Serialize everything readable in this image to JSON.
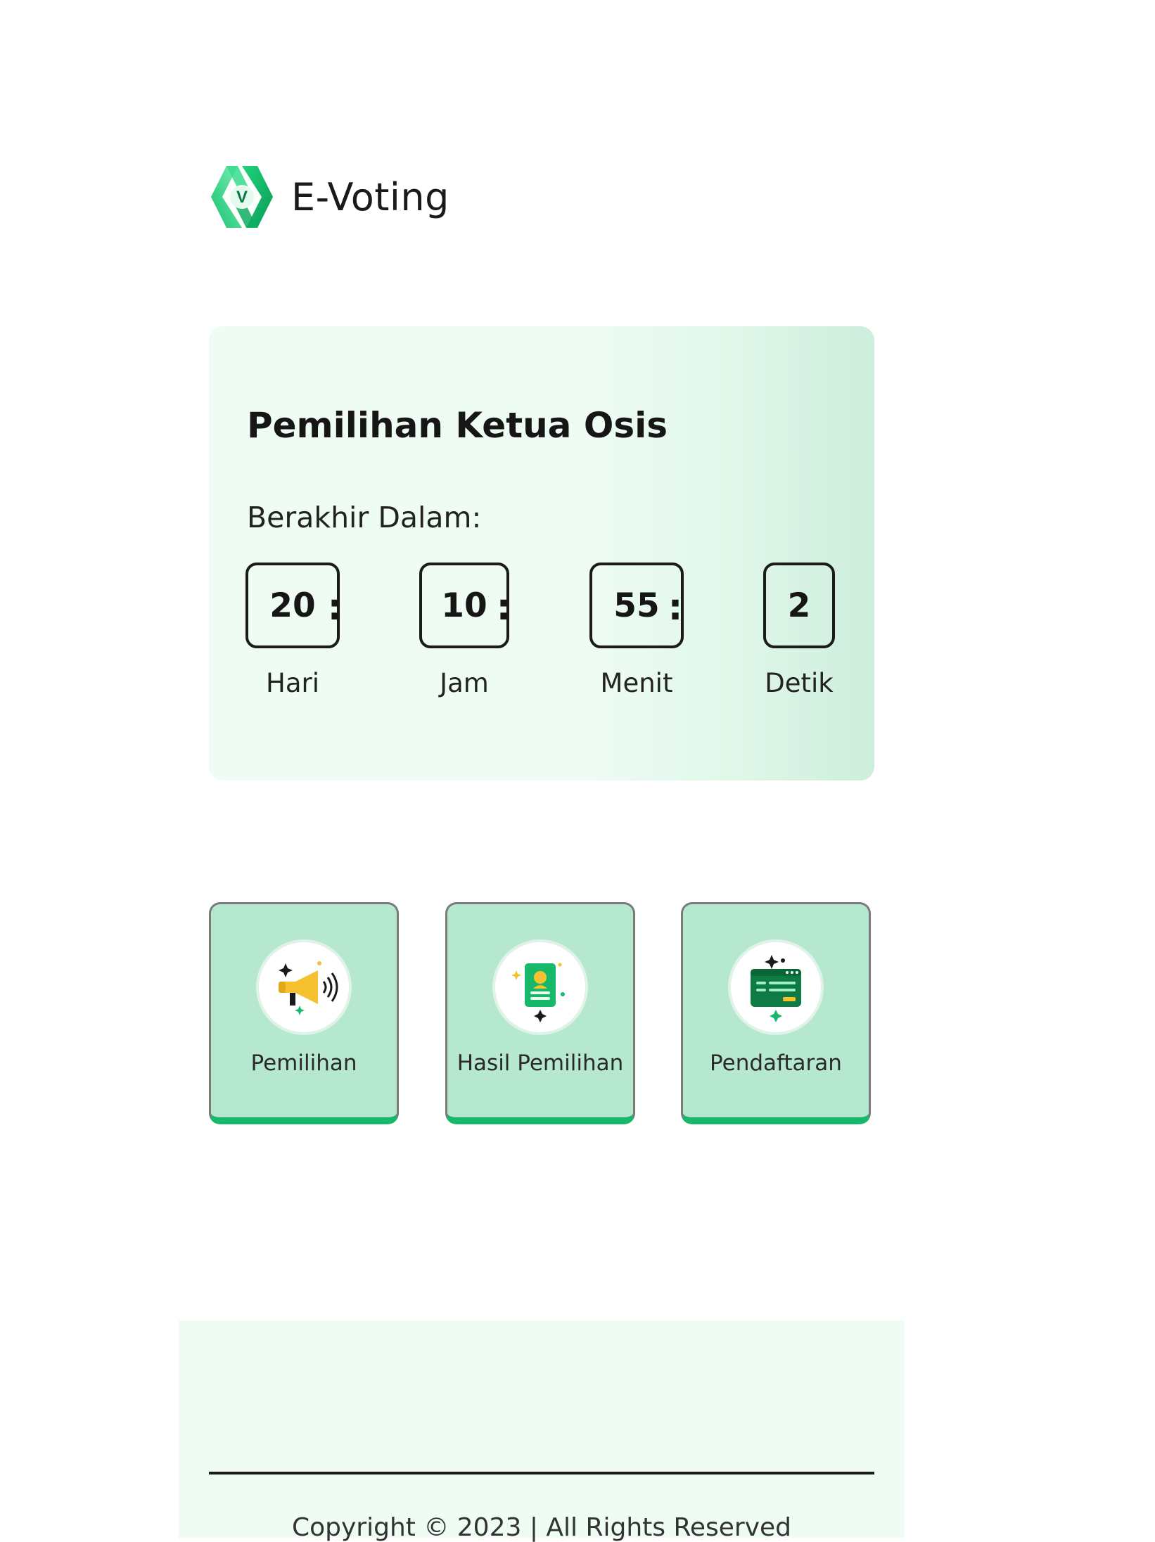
{
  "brand": {
    "name": "E-Voting",
    "logo_letter": "V"
  },
  "countdown": {
    "title": "Pemilihan Ketua Osis",
    "subtitle": "Berakhir Dalam:",
    "separator": ":",
    "units": [
      {
        "value": "20",
        "label": "Hari"
      },
      {
        "value": "10",
        "label": "Jam"
      },
      {
        "value": "55",
        "label": "Menit"
      },
      {
        "value": "2",
        "label": "Detik"
      }
    ]
  },
  "menu": [
    {
      "label": "Pemilihan",
      "icon": "megaphone-icon"
    },
    {
      "label": "Hasil Pemilihan",
      "icon": "id-card-icon"
    },
    {
      "label": "Pendaftaran",
      "icon": "browser-form-icon"
    }
  ],
  "footer": {
    "copyright": "Copyright © 2023 | All Rights Reserved"
  },
  "colors": {
    "accent": "#18b86a",
    "card_bg": "#eefcf3",
    "menu_bg": "#b6e8d0",
    "icon_yellow": "#f5c12e",
    "icon_dark_green": "#0e7a44"
  }
}
